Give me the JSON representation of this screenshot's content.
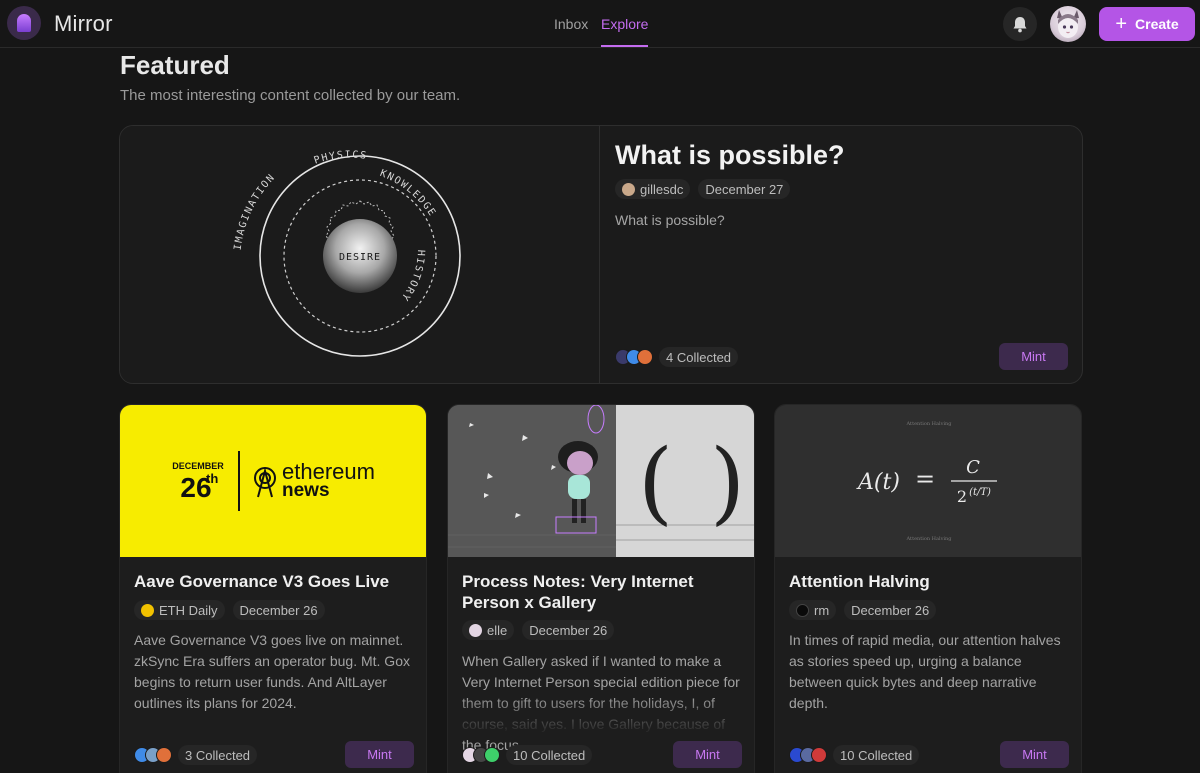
{
  "app": {
    "brand": "Mirror"
  },
  "nav": {
    "tabs": [
      {
        "label": "Inbox"
      },
      {
        "label": "Explore"
      }
    ],
    "create_label": "Create"
  },
  "featured": {
    "heading": "Featured",
    "subheading": "The most interesting content collected by our team.",
    "card": {
      "title": "What is possible?",
      "author": "gillesdc",
      "date": "December 27",
      "description": "What is possible?",
      "collected": "4 Collected",
      "mint_label": "Mint",
      "image_words": {
        "imagination": "IMAGINATION",
        "physics": "PHYSICS",
        "knowledge": "KNOWLEDGE",
        "history": "HISTORY",
        "desire": "DESIRE"
      }
    }
  },
  "cards": [
    {
      "title": "Aave Governance V3 Goes Live",
      "author": "ETH Daily",
      "date": "December 26",
      "description": "Aave Governance V3 goes live on mainnet. zkSync Era suffers an operator bug. Mt. Gox begins to return user funds. And AltLayer outlines its plans for 2024.",
      "collected": "3 Collected",
      "mint_label": "Mint",
      "image_text": {
        "month": "DECEMBER",
        "day": "26",
        "suffix": "th",
        "brand_top": "ethereum",
        "brand_bottom": "news"
      }
    },
    {
      "title": "Process Notes: Very Internet Person x Gallery",
      "author": "elle",
      "date": "December 26",
      "description": "When Gallery asked if I wanted to make a Very Internet Person special edition piece for them to gift to users for the holidays, I, of course, said yes. I love Gallery because of the focus",
      "collected": "10 Collected",
      "mint_label": "Mint"
    },
    {
      "title": "Attention Halving",
      "author": "rm",
      "date": "December 26",
      "description": "In times of rapid media, our attention halves as stories speed up, urging a balance between quick bytes and deep narrative depth.",
      "collected": "10 Collected",
      "mint_label": "Mint",
      "image_text": {
        "formula_left": "A(t)",
        "equals": "=",
        "numerator": "C",
        "denominator": "2",
        "exponent": "(t/T)",
        "caption_top": "Attention Halving",
        "caption_bottom": "Attention Halving"
      }
    }
  ],
  "colors": {
    "accent": "#b455e6",
    "accent_text": "#c46cf0",
    "background": "#161616",
    "card": "#1d1d1d",
    "eth_yellow": "#f7ec00"
  }
}
